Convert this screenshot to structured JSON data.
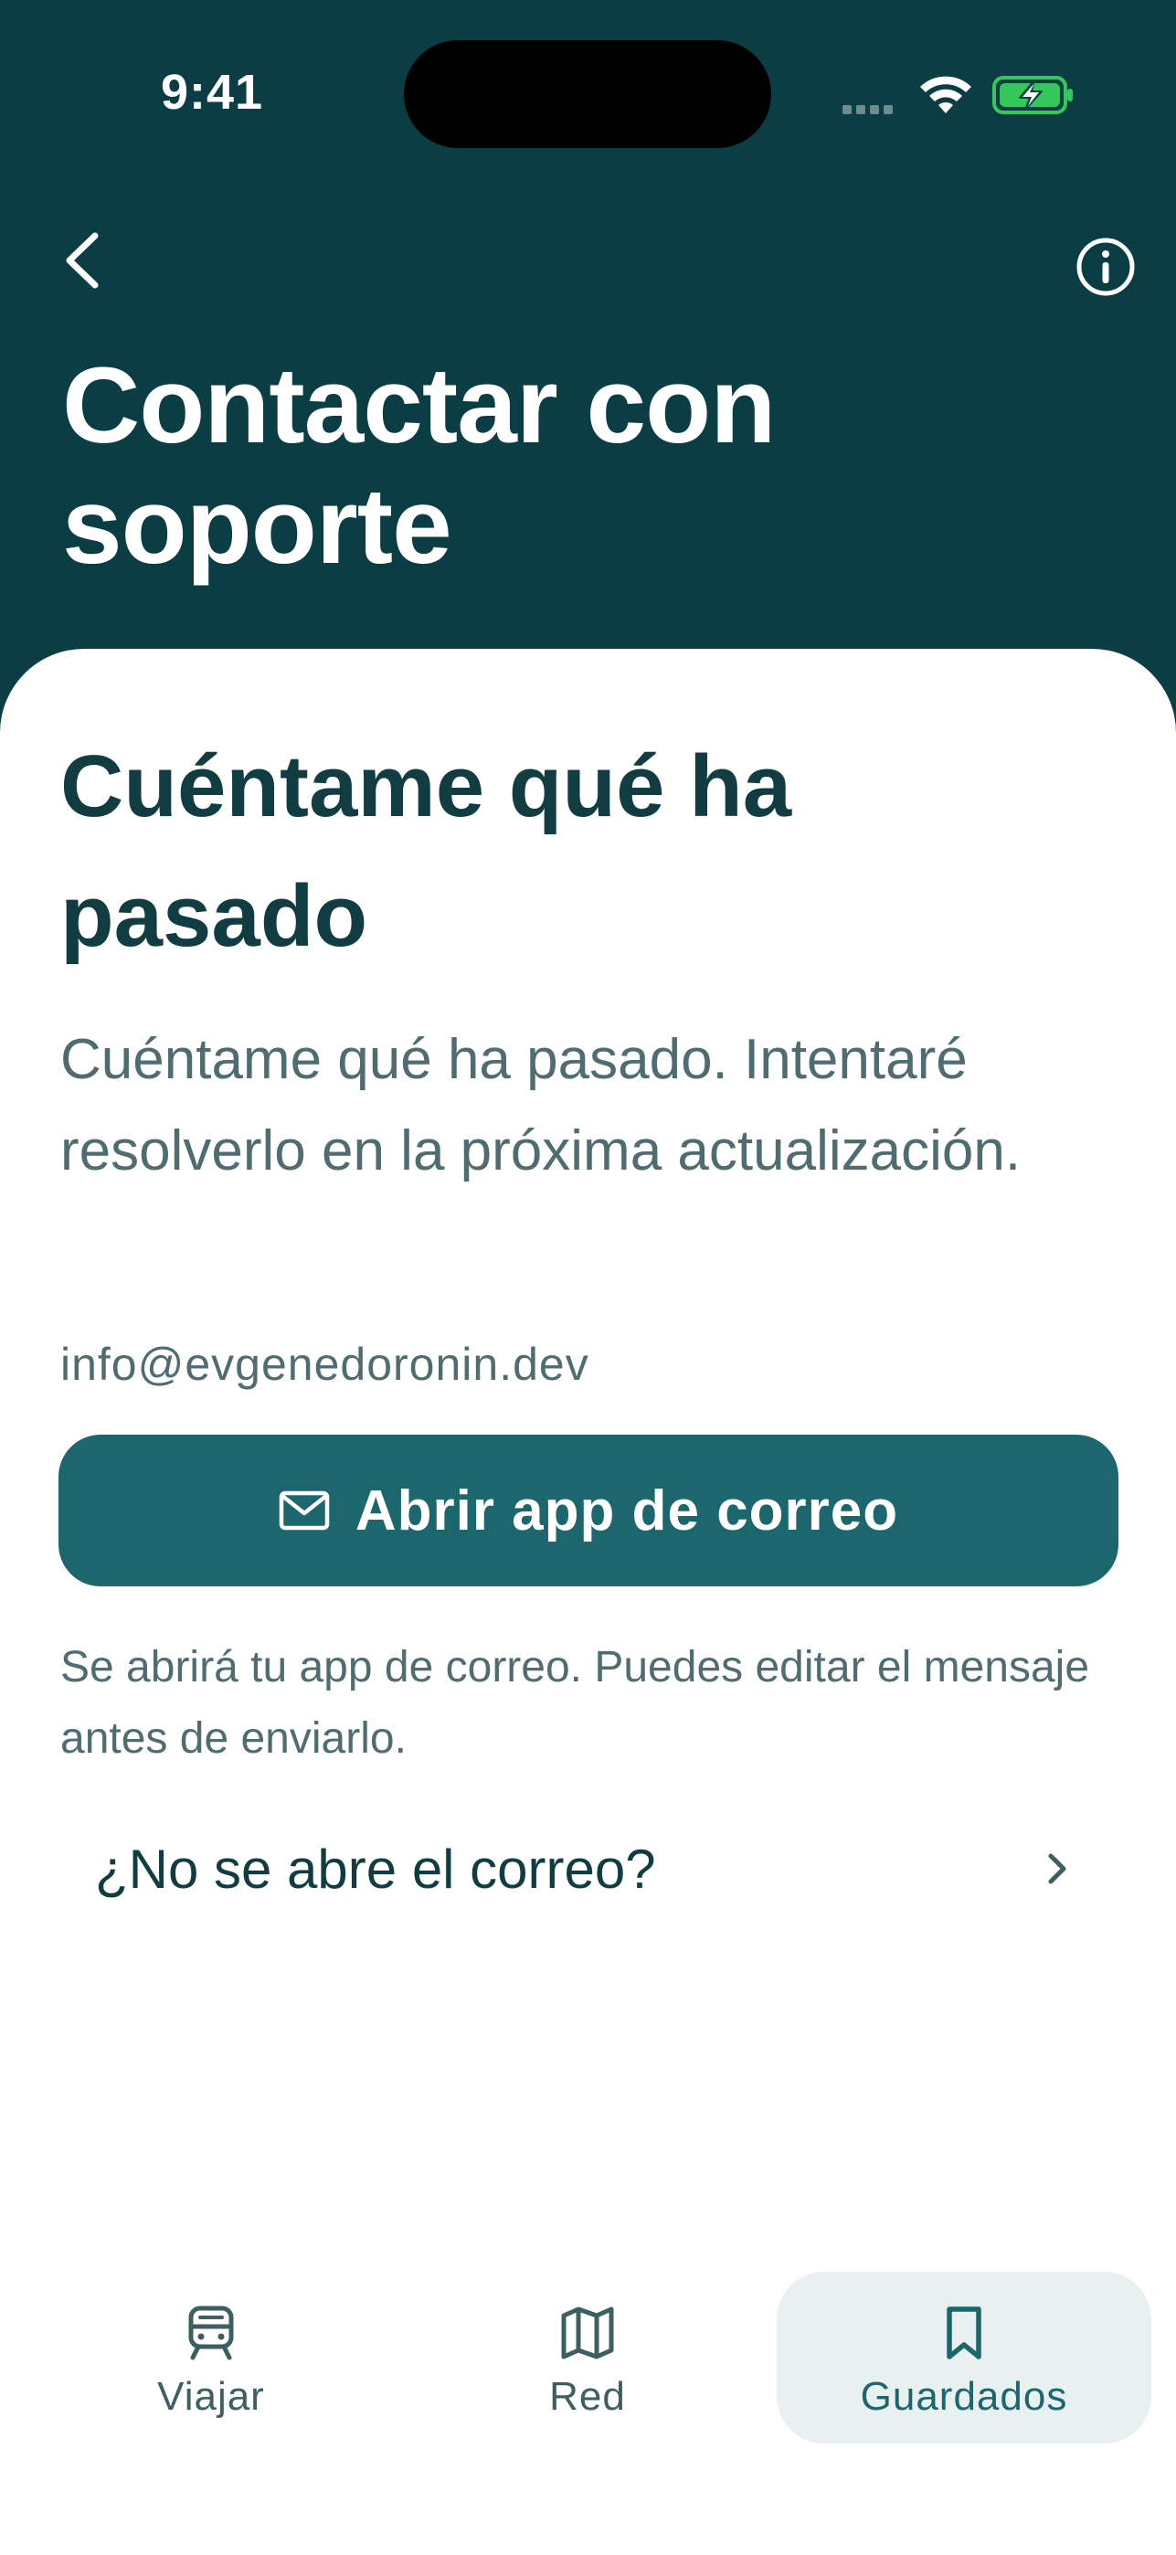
{
  "status_bar": {
    "time": "9:41"
  },
  "header": {
    "back_icon": "chevron-left-icon",
    "info_icon": "info-icon",
    "title": "Contactar con soporte"
  },
  "card": {
    "heading": "Cuéntame qué ha pasado",
    "description": "Cuéntame qué ha pasado. Intentaré resolverlo en la próxima actualización.",
    "email": "info@evgenedoronin.dev",
    "button": {
      "icon": "mail-icon",
      "label": "Abrir app de correo"
    },
    "helper": "Se abrirá tu app de correo. Puedes editar el mensaje antes de enviarlo.",
    "link": {
      "label": "¿No se abre el correo?",
      "icon": "chevron-right-icon"
    }
  },
  "tabbar": {
    "tabs": [
      {
        "label": "Viajar",
        "icon": "train-icon",
        "active": false
      },
      {
        "label": "Red",
        "icon": "map-icon",
        "active": false
      },
      {
        "label": "Guardados",
        "icon": "bookmark-icon",
        "active": true
      }
    ]
  },
  "colors": {
    "header_bg": "#0b3d44",
    "primary": "#1b676d",
    "text_dark": "#113c42",
    "text_muted": "#4f6d70",
    "active_tab_bg": "#e8f1ef",
    "battery_green": "#34c759"
  }
}
